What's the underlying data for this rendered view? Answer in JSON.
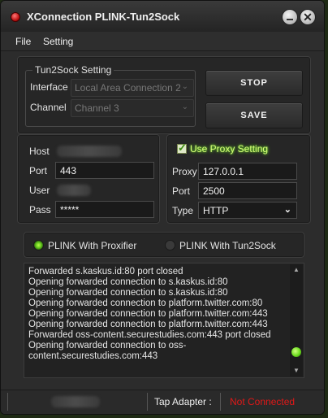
{
  "window": {
    "title": "XConnection PLINK-Tun2Sock",
    "minimize_glyph": "",
    "close_glyph": "✕"
  },
  "menu": {
    "items": [
      {
        "label": "File"
      },
      {
        "label": "Setting"
      }
    ]
  },
  "tun2sock": {
    "legend": "Tun2Sock Setting",
    "interface_label": "Interface",
    "interface_value": "Local Area Connection 2",
    "channel_label": "Channel",
    "channel_value": "Channel 3"
  },
  "buttons": {
    "stop": "STOP",
    "save": "SAVE"
  },
  "server": {
    "host_label": "Host",
    "port_label": "Port",
    "port_value": "443",
    "user_label": "User",
    "pass_label": "Pass",
    "pass_value": "*****"
  },
  "proxy": {
    "use_proxy_label": "Use Proxy Setting",
    "use_proxy_checked": true,
    "proxy_label": "Proxy",
    "proxy_value": "127.0.0.1",
    "port_label": "Port",
    "port_value": "2500",
    "type_label": "Type",
    "type_value": "HTTP"
  },
  "mode": {
    "option1": "PLINK With Proxifier",
    "option1_selected": true,
    "option2": "PLINK With Tun2Sock",
    "option2_selected": false
  },
  "log": {
    "lines": [
      "Forwarded s.kaskus.id:80 port closed",
      "Opening forwarded connection to s.kaskus.id:80",
      "Opening forwarded connection to s.kaskus.id:80",
      "Opening forwarded connection to platform.twitter.com:80",
      "Opening forwarded connection to platform.twitter.com:443",
      "Opening forwarded connection to platform.twitter.com:443",
      "Forwarded oss-content.securestudies.com:443 port closed",
      "Opening forwarded connection to oss-",
      "content.securestudies.com:443"
    ]
  },
  "status": {
    "tap_adapter_label": "Tap Adapter :",
    "tap_adapter_value": "Not Connected"
  },
  "colors": {
    "accent_green": "#6bd32a",
    "status_error": "#e01818"
  },
  "icons": {
    "title": "app-red-dot-icon",
    "minimize": "minimize-icon",
    "close": "close-icon",
    "dropdown": "chevron-down-icon",
    "check": "checkmark-icon"
  }
}
